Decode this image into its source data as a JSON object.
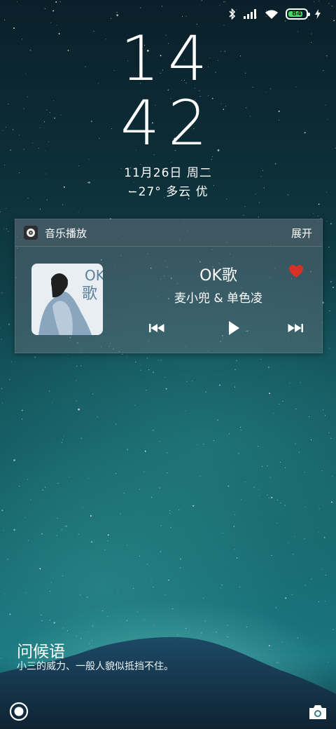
{
  "status_bar": {
    "icons": [
      "bluetooth-icon",
      "signal-icon",
      "wifi-icon",
      "battery-icon",
      "charging-icon"
    ],
    "battery_percent": "84",
    "battery_level": 0.84,
    "battery_color": "#4cd964"
  },
  "clock": {
    "hour": "14",
    "minute": "42"
  },
  "date": "11月26日 周二",
  "weather": "−27° 多云 优",
  "music_card": {
    "app_title": "音乐播放",
    "expand_label": "展开",
    "song_title": "OK歌",
    "artist": "麦小兜 & 单色凌",
    "favorite_color": "#d93025",
    "controls": [
      "previous-icon",
      "play-icon",
      "next-icon"
    ],
    "album_art_text": "OK 歌"
  },
  "greeting": {
    "title": "问候语",
    "text": "小三的威力、一般人貌似抵挡不住。"
  },
  "bottom": {
    "left_icon": "circle-target-icon",
    "right_icon": "camera-icon"
  }
}
